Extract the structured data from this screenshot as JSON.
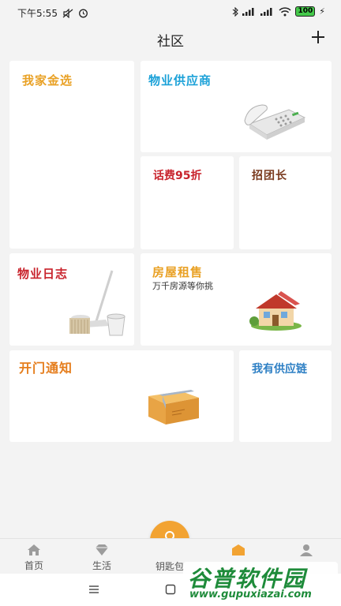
{
  "status": {
    "time": "下午5:55",
    "battery": "100"
  },
  "header": {
    "title": "社区"
  },
  "cards": {
    "jinxuan": {
      "title": "我家金选",
      "color": "#e9a125"
    },
    "supplier": {
      "title": "物业供应商",
      "color": "#1ba1d8"
    },
    "phonebill": {
      "title": "话费95折",
      "color": "#c8232c"
    },
    "leader": {
      "title": "招团长",
      "color": "#7a3a1e"
    },
    "log": {
      "title": "物业日志",
      "color": "#c8232c"
    },
    "house": {
      "title": "房屋租售",
      "subtitle": "万千房源等你挑",
      "color": "#e9a125"
    },
    "door": {
      "title": "开门通知",
      "color": "#e57d1c"
    },
    "chain": {
      "title": "我有供应链",
      "color": "#2d7fc4"
    }
  },
  "tabbar": {
    "home": "首页",
    "life": "生活",
    "key": "钥匙包"
  },
  "watermark": {
    "cn": "谷普软件园",
    "url": "www.gupuxiazai.com"
  }
}
